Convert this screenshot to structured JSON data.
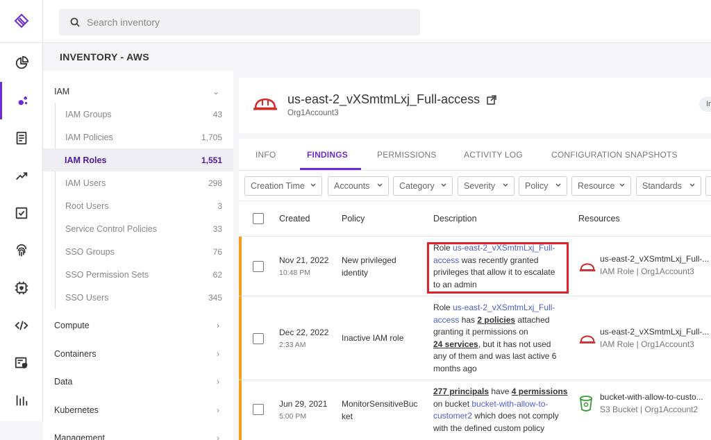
{
  "search": {
    "placeholder": "Search inventory"
  },
  "inventory": {
    "title": "INVENTORY - AWS",
    "categories_top": {
      "label": "IAM"
    },
    "iam_items": [
      {
        "label": "IAM Groups",
        "count": "43"
      },
      {
        "label": "IAM Policies",
        "count": "1,705"
      },
      {
        "label": "IAM Roles",
        "count": "1,551"
      },
      {
        "label": "IAM Users",
        "count": "298"
      },
      {
        "label": "Root Users",
        "count": "3"
      },
      {
        "label": "Service Control Policies",
        "count": "33"
      },
      {
        "label": "SSO Groups",
        "count": "76"
      },
      {
        "label": "SSO Permission Sets",
        "count": "62"
      },
      {
        "label": "SSO Users",
        "count": "345"
      }
    ],
    "categories": [
      {
        "label": "Compute"
      },
      {
        "label": "Containers"
      },
      {
        "label": "Data"
      },
      {
        "label": "Kubernetes"
      },
      {
        "label": "Management"
      }
    ]
  },
  "resource": {
    "title": "us-east-2_vXSmtmLxj_Full-access",
    "account": "Org1Account3",
    "pill": "In"
  },
  "tabs": [
    "INFO",
    "FINDINGS",
    "PERMISSIONS",
    "ACTIVITY LOG",
    "CONFIGURATION SNAPSHOTS"
  ],
  "filters": [
    "Creation Time",
    "Accounts",
    "Category",
    "Severity",
    "Policy",
    "Resource",
    "Standards"
  ],
  "table": {
    "headers": {
      "created": "Created",
      "policy": "Policy",
      "description": "Description",
      "resources": "Resources"
    },
    "rows": [
      {
        "date": "Nov 21, 2022",
        "time": "10:48 PM",
        "policy_l1": "New privileged",
        "policy_l2": "identity",
        "d1_a": "Role ",
        "d1_link": "us-east-2_vXSmtmLxj_Full-",
        "d2_link": "access",
        "d2_b": " was recently granted",
        "d3": "privileges that allow it to escalate",
        "d4": "to an admin",
        "res_name": "us-east-2_vXSmtmLxj_Full-...",
        "res_type": "IAM Role | Org1Account3"
      },
      {
        "date": "Dec 22, 2022",
        "time": "2:33 AM",
        "policy_l1": "Inactive IAM role",
        "d1_a": "Role ",
        "d1_link": "us-east-2_vXSmtmLxj_Full-",
        "d2_link": "access",
        "d2_b": " has ",
        "d2_bold": "2 policies",
        "d2_c": " attached",
        "d3": "granting it permissions on",
        "d4_bold": "24 services",
        "d4_b": ", but it has not used",
        "d5": "any of them and was last active 6",
        "d6": "months ago",
        "res_name": "us-east-2_vXSmtmLxj_Full-...",
        "res_type": "IAM Role | Org1Account3"
      },
      {
        "date": "Jun 29, 2021",
        "time": "5:00 PM",
        "policy_l1": "MonitorSensitiveBuc",
        "policy_l2": "ket",
        "d1_bold": "277 principals",
        "d1_b": " have ",
        "d1_bold2": "4 permissions",
        "d2_a": "on bucket ",
        "d2_link": "bucket-with-allow-to-",
        "d3_link": "customer2",
        "d3_b": " which does not comply",
        "d4": "with the defined custom policy",
        "res_name": "bucket-with-allow-to-custo...",
        "res_type": "S3 Bucket | Org1Account2"
      }
    ]
  },
  "colors": {
    "accent": "#6c2bd9",
    "warning": "#f59c1a",
    "highlight": "#e0202a",
    "link": "#4a5fcf"
  }
}
